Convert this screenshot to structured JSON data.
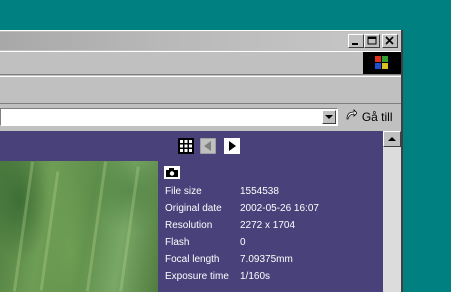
{
  "window": {
    "title_buttons": [
      "minimize-icon",
      "maximize-icon",
      "close-icon"
    ]
  },
  "addressbar": {
    "url": "",
    "go_label": "Gå till"
  },
  "viewer": {
    "nav_icons": [
      "thumbnails-grid-icon",
      "previous-arrow-icon",
      "next-arrow-icon"
    ],
    "info_icon": "camera-icon",
    "fields": [
      {
        "label": "File size",
        "value": "1554538"
      },
      {
        "label": "Original date",
        "value": "2002-05-26 16:07"
      },
      {
        "label": "Resolution",
        "value": "2272 x 1704"
      },
      {
        "label": "Flash",
        "value": "0"
      },
      {
        "label": "Focal length",
        "value": "7.09375mm"
      },
      {
        "label": "Exposure time",
        "value": "1/160s"
      }
    ]
  },
  "colors": {
    "desktop": "#008080",
    "viewer_background": "#48417a",
    "chrome": "#c0c0c0"
  }
}
